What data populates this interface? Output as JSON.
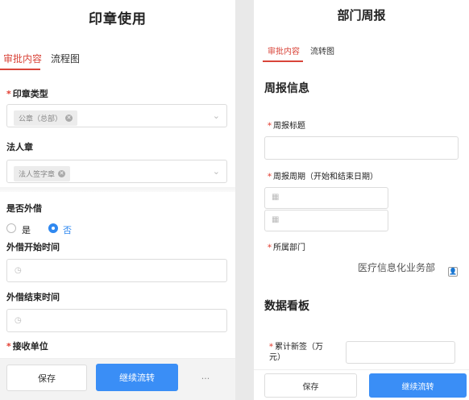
{
  "left": {
    "title": "印章使用",
    "tabs": [
      {
        "label": "审批内容"
      },
      {
        "label": "流程图"
      }
    ],
    "seal_type": {
      "label": "印章类型",
      "required": "*",
      "tag": "公章（总部）"
    },
    "legal_seal": {
      "label": "法人章",
      "tag": "法人签字章"
    },
    "external": {
      "label": "是否外借",
      "options": [
        "是",
        "否"
      ],
      "selected": "否"
    },
    "borrow_start": {
      "label": "外借开始时间"
    },
    "borrow_end": {
      "label": "外借结束时间"
    },
    "receiver": {
      "label": "接收单位",
      "required": "*"
    },
    "footer": {
      "save": "保存",
      "continue": "继续流转",
      "more": "···"
    }
  },
  "right": {
    "title": "部门周报",
    "tabs": [
      {
        "label": "审批内容"
      },
      {
        "label": "流转图"
      }
    ],
    "section1": "周报信息",
    "report_title": {
      "label": "周报标题",
      "required": "*"
    },
    "report_period": {
      "label": "周报周期（开始和结束日期）",
      "required": "*"
    },
    "department": {
      "label": "所属部门",
      "required": "*",
      "value": "医疗信息化业务部"
    },
    "section2": "数据看板",
    "new_signed": {
      "label": "累计新签（万元）",
      "required": "*"
    },
    "footer": {
      "save": "保存",
      "continue": "继续流转"
    }
  },
  "colors": {
    "accent_red": "#d9453a",
    "primary_blue": "#3a8ef6",
    "required_red": "#e23b2e"
  }
}
